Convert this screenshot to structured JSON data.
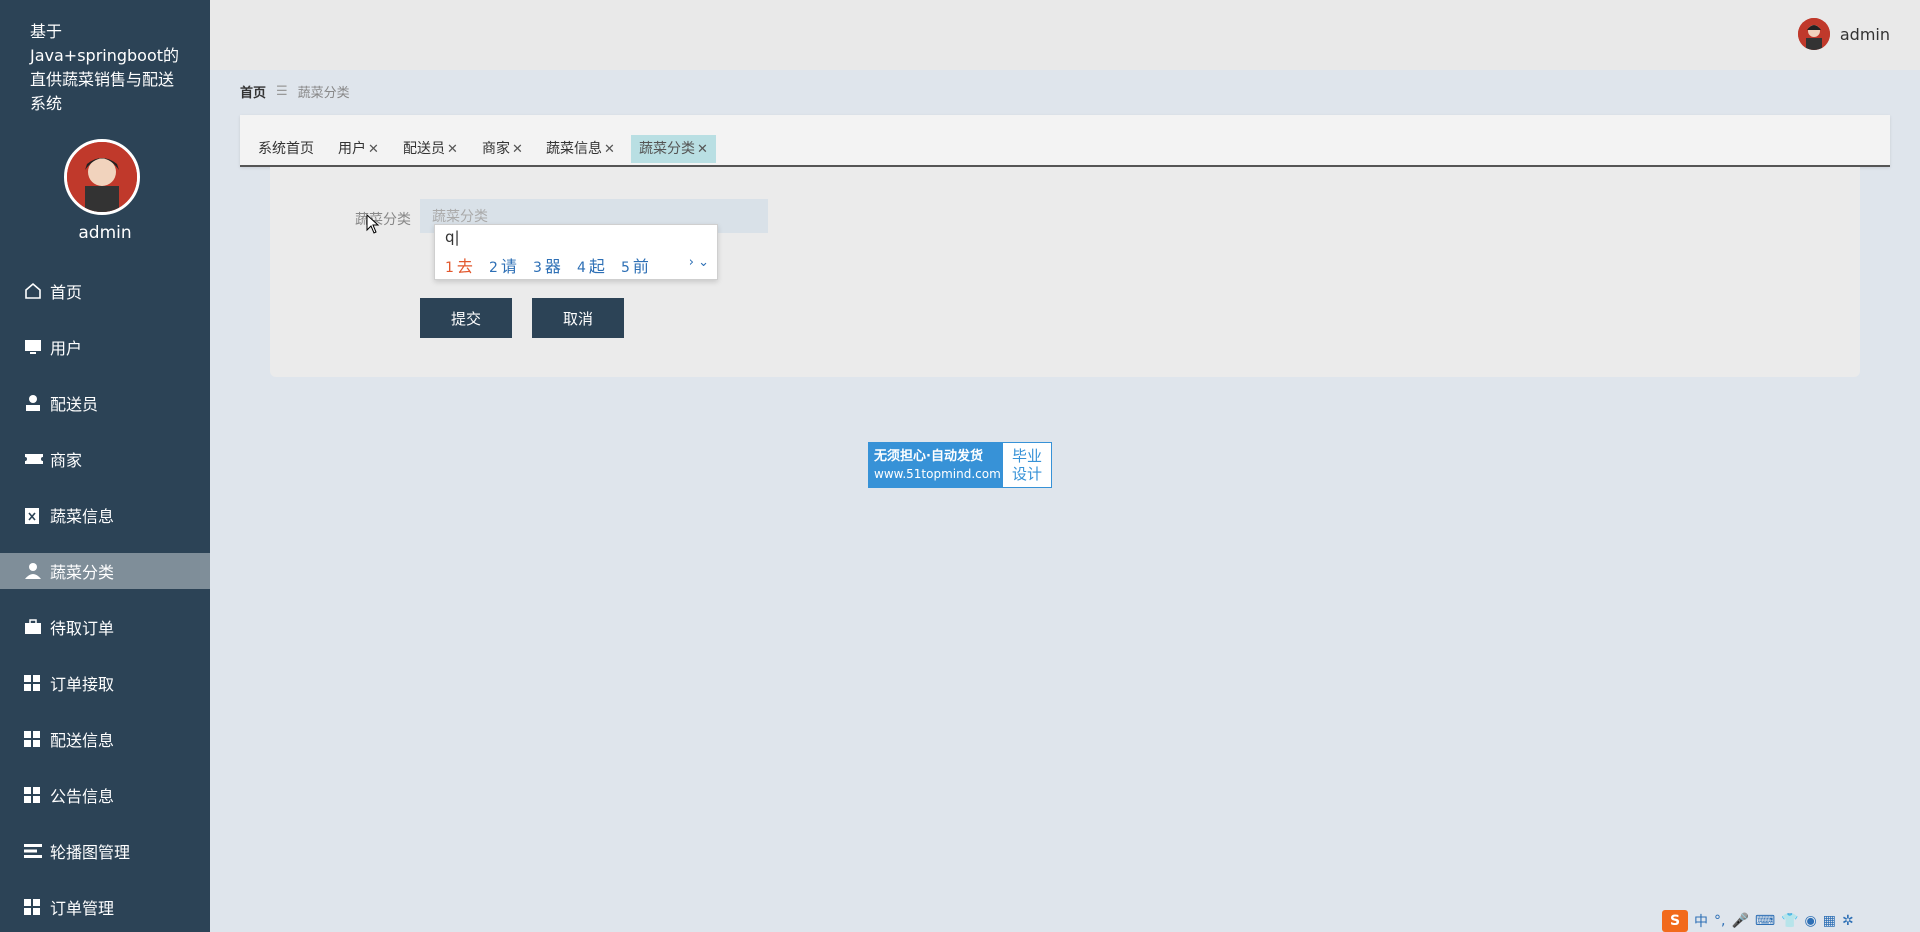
{
  "sidebar": {
    "title": "基于Java+springboot的直供蔬菜销售与配送系统",
    "username": "admin",
    "items": [
      {
        "label": "首页",
        "icon": "home-icon"
      },
      {
        "label": "用户",
        "icon": "monitor-icon"
      },
      {
        "label": "配送员",
        "icon": "user-icon"
      },
      {
        "label": "商家",
        "icon": "ticket-icon"
      },
      {
        "label": "蔬菜信息",
        "icon": "clipboard-icon"
      },
      {
        "label": "蔬菜分类",
        "icon": "user-icon",
        "active": true
      },
      {
        "label": "待取订单",
        "icon": "briefcase-icon"
      },
      {
        "label": "订单接取",
        "icon": "grid-icon"
      },
      {
        "label": "配送信息",
        "icon": "grid-icon"
      },
      {
        "label": "公告信息",
        "icon": "grid-icon"
      },
      {
        "label": "轮播图管理",
        "icon": "list-icon"
      },
      {
        "label": "订单管理",
        "icon": "grid-icon"
      }
    ]
  },
  "topbar": {
    "username": "admin"
  },
  "breadcrumb": {
    "home": "首页",
    "separator": "☰",
    "current": "蔬菜分类"
  },
  "tabs": [
    {
      "label": "系统首页",
      "closable": false
    },
    {
      "label": "用户",
      "closable": true
    },
    {
      "label": "配送员",
      "closable": true
    },
    {
      "label": "商家",
      "closable": true
    },
    {
      "label": "蔬菜信息",
      "closable": true
    },
    {
      "label": "蔬菜分类",
      "closable": true,
      "active": true
    }
  ],
  "form": {
    "field_label": "蔬菜分类",
    "field_placeholder": "蔬菜分类",
    "submit_label": "提交",
    "cancel_label": "取消"
  },
  "ime": {
    "input": "q",
    "candidates": [
      {
        "n": "1",
        "text": "去"
      },
      {
        "n": "2",
        "text": "请"
      },
      {
        "n": "3",
        "text": "器"
      },
      {
        "n": "4",
        "text": "起"
      },
      {
        "n": "5",
        "text": "前"
      }
    ]
  },
  "watermark": {
    "line1": "无须担心·自动发货",
    "line2": "www.51topmind.com",
    "right1": "毕业",
    "right2": "设计"
  },
  "tray": {
    "lang": "中"
  },
  "colors": {
    "sidebar_bg": "#2c4356",
    "active_tab": "#b9dfe3",
    "button_bg": "#2c4356",
    "watermark": "#3792d7"
  }
}
